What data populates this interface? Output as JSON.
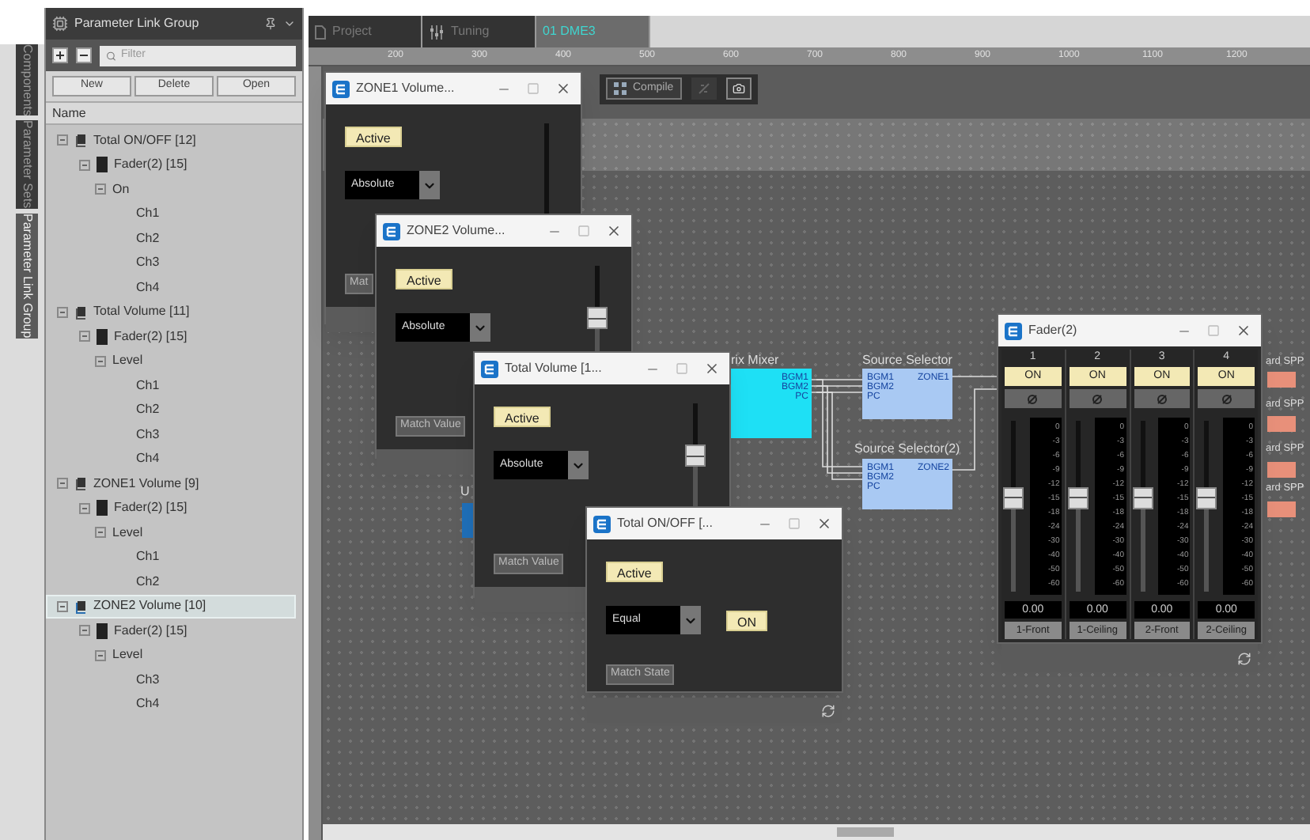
{
  "side_tabs": [
    {
      "label": "Components",
      "selected": false
    },
    {
      "label": "Parameter Sets",
      "selected": false
    },
    {
      "label": "Parameter Link Group",
      "selected": true
    }
  ],
  "panel": {
    "title": "Parameter Link Group",
    "filter": {
      "placeholder": "Filter"
    },
    "buttons": [
      "New",
      "Delete",
      "Open"
    ],
    "column": "Name",
    "tree": [
      {
        "label": "Total ON/OFF [12]",
        "kind": "group",
        "selected": false,
        "expanded": true,
        "children": [
          {
            "label": "Fader(2) [15]",
            "kind": "component",
            "expanded": true,
            "children": [
              {
                "label": "On",
                "expanded": true,
                "children": [
                  {
                    "label": "Ch1"
                  },
                  {
                    "label": "Ch2"
                  },
                  {
                    "label": "Ch3"
                  },
                  {
                    "label": "Ch4"
                  }
                ]
              }
            ]
          }
        ]
      },
      {
        "label": "Total Volume [11]",
        "kind": "group",
        "selected": false,
        "expanded": true,
        "children": [
          {
            "label": "Fader(2) [15]",
            "kind": "component",
            "expanded": true,
            "children": [
              {
                "label": "Level",
                "expanded": true,
                "children": [
                  {
                    "label": "Ch1"
                  },
                  {
                    "label": "Ch2"
                  },
                  {
                    "label": "Ch3"
                  },
                  {
                    "label": "Ch4"
                  }
                ]
              }
            ]
          }
        ]
      },
      {
        "label": "ZONE1 Volume [9]",
        "kind": "group",
        "selected": false,
        "expanded": true,
        "children": [
          {
            "label": "Fader(2) [15]",
            "kind": "component",
            "expanded": true,
            "children": [
              {
                "label": "Level",
                "expanded": true,
                "children": [
                  {
                    "label": "Ch1"
                  },
                  {
                    "label": "Ch2"
                  }
                ]
              }
            ]
          }
        ]
      },
      {
        "label": "ZONE2 Volume [10]",
        "kind": "group",
        "selected": true,
        "expanded": true,
        "children": [
          {
            "label": "Fader(2) [15]",
            "kind": "component",
            "expanded": true,
            "children": [
              {
                "label": "Level",
                "expanded": true,
                "children": [
                  {
                    "label": "Ch3"
                  },
                  {
                    "label": "Ch4"
                  }
                ]
              }
            ]
          }
        ]
      }
    ]
  },
  "doc_tabs": [
    {
      "label": "Project",
      "kind": "project",
      "selected": false
    },
    {
      "label": "Tuning",
      "kind": "tuning",
      "selected": false
    },
    {
      "label": "01 DME3",
      "kind": "device",
      "selected": true
    }
  ],
  "ruler": [
    "200",
    "300",
    "400",
    "500",
    "600",
    "700",
    "800",
    "900",
    "1000",
    "1100",
    "1200"
  ],
  "toolbar": {
    "compile": "Compile"
  },
  "canvas": {
    "blocks": [
      {
        "kind": "stub",
        "label": "U"
      },
      {
        "kind": "mixer",
        "label": "rix Mixer",
        "ports": [
          "BGM1",
          "BGM2",
          "PC"
        ]
      },
      {
        "kind": "selector",
        "label": "Source Selector",
        "ports": [
          "BGM1",
          "BGM2",
          "PC"
        ],
        "output": "ZONE1"
      },
      {
        "kind": "selector",
        "label": "Source Selector(2)",
        "ports": [
          "BGM1",
          "BGM2",
          "PC"
        ],
        "output": "ZONE2"
      },
      {
        "kind": "output",
        "label": "ard SPP"
      },
      {
        "kind": "output",
        "label": "ard SPP"
      },
      {
        "kind": "output",
        "label": "ard SPP"
      },
      {
        "kind": "output",
        "label": "ard SPP"
      }
    ]
  },
  "windows": [
    {
      "kind": "volume",
      "title": "ZONE1 Volume...",
      "active_label": "Active",
      "active": true,
      "mode": "Absolute",
      "match": "Mat"
    },
    {
      "kind": "volume",
      "title": "ZONE2 Volume...",
      "active_label": "Active",
      "active": true,
      "mode": "Absolute",
      "match": "Match Value",
      "level": 0.7
    },
    {
      "kind": "volume",
      "title": "Total Volume [1...",
      "active_label": "Active",
      "active": true,
      "mode": "Absolute",
      "match": "Match Value",
      "level": 0.7
    },
    {
      "kind": "onoff",
      "title": "Total ON/OFF [...",
      "active_label": "Active",
      "active": true,
      "mode": "Equal",
      "match": "Match State",
      "on_label": "ON",
      "on": true
    }
  ],
  "fader_window": {
    "title": "Fader(2)",
    "channels": [
      {
        "number": "1",
        "on_label": "ON",
        "on": true,
        "level": 0.55,
        "scale": [
          "0",
          "-3",
          "-6",
          "-9",
          "-12",
          "-15",
          "-18",
          "-24",
          "-30",
          "-40",
          "-50",
          "-60"
        ],
        "value": "0.00",
        "name": "1-Front"
      },
      {
        "number": "2",
        "on_label": "ON",
        "on": true,
        "level": 0.55,
        "scale": [
          "0",
          "-3",
          "-6",
          "-9",
          "-12",
          "-15",
          "-18",
          "-24",
          "-30",
          "-40",
          "-50",
          "-60"
        ],
        "value": "0.00",
        "name": "1-Ceiling"
      },
      {
        "number": "3",
        "on_label": "ON",
        "on": true,
        "level": 0.55,
        "scale": [
          "0",
          "-3",
          "-6",
          "-9",
          "-12",
          "-15",
          "-18",
          "-24",
          "-30",
          "-40",
          "-50",
          "-60"
        ],
        "value": "0.00",
        "name": "2-Front"
      },
      {
        "number": "4",
        "on_label": "ON",
        "on": true,
        "level": 0.55,
        "scale": [
          "0",
          "-3",
          "-6",
          "-9",
          "-12",
          "-15",
          "-18",
          "-24",
          "-30",
          "-40",
          "-50",
          "-60"
        ],
        "value": "0.00",
        "name": "2-Ceiling"
      }
    ]
  }
}
